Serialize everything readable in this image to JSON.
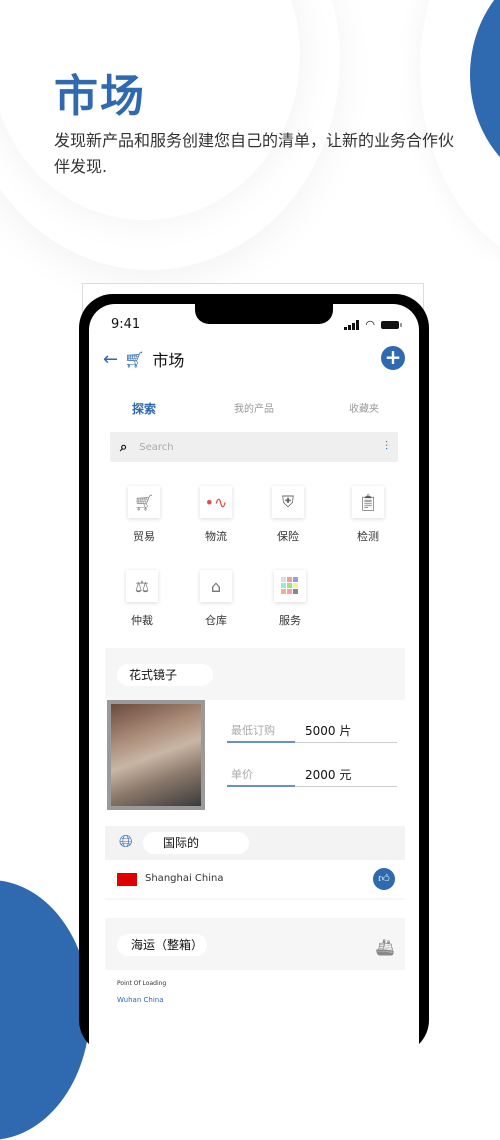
{
  "hero": {
    "title": "市场",
    "description": "发现新产品和服务创建您自己的清单，让新的业务合作伙伴发现."
  },
  "status_bar": {
    "time": "9:41"
  },
  "nav": {
    "title": "市场",
    "back_icon": "arrow-left-icon",
    "cart_icon": "cart-icon",
    "add_icon": "plus-icon"
  },
  "tabs": [
    {
      "label": "探索",
      "active": true
    },
    {
      "label": "我的产品",
      "active": false
    },
    {
      "label": "收藏夹",
      "active": false
    }
  ],
  "search": {
    "placeholder": "Search"
  },
  "categories": [
    {
      "label": "贸易",
      "icon": "cart-icon"
    },
    {
      "label": "物流",
      "icon": "route-pin-icon"
    },
    {
      "label": "保险",
      "icon": "shield-check-icon"
    },
    {
      "label": "检测",
      "icon": "inspection-icon"
    },
    {
      "label": "仲裁",
      "icon": "scales-icon"
    },
    {
      "label": "仓库",
      "icon": "warehouse-icon"
    },
    {
      "label": "服务",
      "icon": "grid-colors-icon"
    }
  ],
  "product": {
    "name": "花式镜子",
    "min_order_label": "最低订购",
    "min_order_value": "5000 片",
    "price_label": "单价",
    "price_value": "2000 元",
    "scope": "国际的",
    "location": "Shanghai China"
  },
  "shipping": {
    "title": "海运（整箱）",
    "point_label": "Point Of Loading",
    "point_value": "Wuhan China"
  },
  "colors": {
    "accent": "#2f69b0",
    "flag": "#e00000"
  }
}
